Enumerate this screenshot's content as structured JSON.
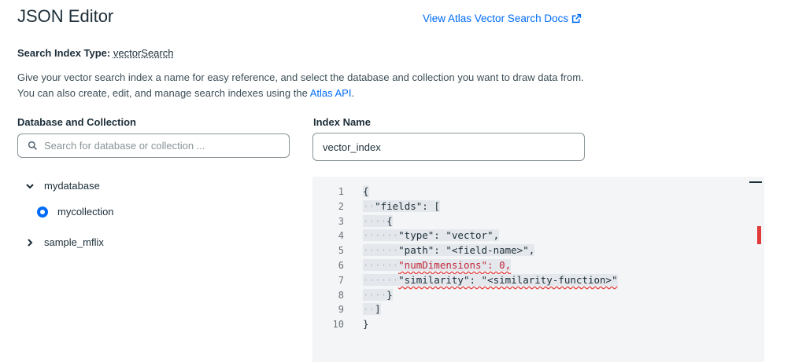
{
  "header": {
    "title": "JSON Editor",
    "docs_link": "View Atlas Vector Search Docs"
  },
  "index_type": {
    "label": "Search Index Type:",
    "value": "vectorSearch"
  },
  "description": {
    "text": "Give your vector search index a name for easy reference, and select the database and collection you want to draw data from. You can also create, edit, and manage search indexes using the ",
    "link": "Atlas API",
    "end": "."
  },
  "database_section": {
    "label": "Database and Collection",
    "search_placeholder": "Search for database or collection ..."
  },
  "index_name": {
    "label": "Index Name",
    "value": "vector_index"
  },
  "tree": {
    "db1": "mydatabase",
    "collection1": "mycollection",
    "db2": "sample_mflix"
  },
  "editor": {
    "line_numbers": [
      "1",
      "2",
      "3",
      "4",
      "5",
      "6",
      "7",
      "8",
      "9",
      "10"
    ],
    "lines": [
      "{",
      "\"fields\": [",
      "{",
      "\"type\": \"vector\",",
      "\"path\": \"<field-name>\",",
      "\"numDimensions\": 0,",
      "\"similarity\": \"<similarity-function>\"",
      "}",
      "]",
      "}"
    ]
  },
  "colors": {
    "link": "#016bf8",
    "error": "#e13a3a",
    "editor_bg": "#f4f5f7"
  }
}
